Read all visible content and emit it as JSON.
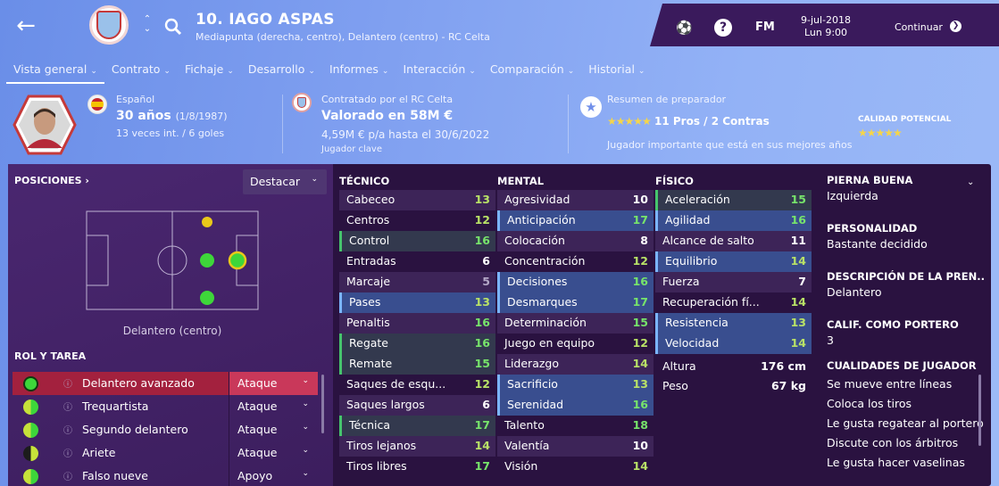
{
  "header": {
    "name": "10. IAGO ASPAS",
    "subtitle": "Mediapunta (derecha, centro), Delantero (centro) - RC Celta",
    "back_icon": "back-arrow-icon",
    "fm": "FM",
    "date": "9-jul-2018",
    "time": "Lun 9:00",
    "continue": "Continuar"
  },
  "tabs": [
    {
      "label": "Vista general"
    },
    {
      "label": "Contrato"
    },
    {
      "label": "Fichaje"
    },
    {
      "label": "Desarrollo"
    },
    {
      "label": "Informes"
    },
    {
      "label": "Interacción"
    },
    {
      "label": "Comparación"
    },
    {
      "label": "Historial"
    }
  ],
  "info": {
    "nationality": "Español",
    "age": "30 años",
    "dob": "(1/8/1987)",
    "caps": "13 veces int. / 6 goles",
    "contract_title": "Contratado por el RC Celta",
    "value": "Valorado en 58M €",
    "wage": "4,59M € p/a hasta el 30/6/2022",
    "status": "Jugador clave",
    "coach_title": "Resumen de preparador",
    "coach_summary": "11 Pros / 2 Contras",
    "coach_note": "Jugador importante que está en sus mejores años",
    "potential_label": "CALIDAD POTENCIAL",
    "coach_stars": 4.5,
    "potential_stars": 4.5
  },
  "positions": {
    "title": "POSICIONES",
    "highlight": "Destacar",
    "pitch_label": "Delantero (centro)"
  },
  "roles": {
    "title": "ROL Y TAREA",
    "items": [
      {
        "name": "Delantero avanzado",
        "task": "Ataque"
      },
      {
        "name": "Trequartista",
        "task": "Ataque"
      },
      {
        "name": "Segundo delantero",
        "task": "Ataque"
      },
      {
        "name": "Ariete",
        "task": "Ataque"
      },
      {
        "name": "Falso nueve",
        "task": "Apoyo"
      }
    ]
  },
  "technical": {
    "title": "TÉCNICO",
    "items": [
      {
        "n": "Cabeceo",
        "v": "13"
      },
      {
        "n": "Centros",
        "v": "12"
      },
      {
        "n": "Control",
        "v": "16"
      },
      {
        "n": "Entradas",
        "v": "6"
      },
      {
        "n": "Marcaje",
        "v": "5"
      },
      {
        "n": "Pases",
        "v": "13"
      },
      {
        "n": "Penaltis",
        "v": "16"
      },
      {
        "n": "Regate",
        "v": "16"
      },
      {
        "n": "Remate",
        "v": "15"
      },
      {
        "n": "Saques de esqu...",
        "v": "12"
      },
      {
        "n": "Saques largos",
        "v": "6"
      },
      {
        "n": "Técnica",
        "v": "17"
      },
      {
        "n": "Tiros lejanos",
        "v": "14"
      },
      {
        "n": "Tiros libres",
        "v": "17"
      }
    ]
  },
  "mental": {
    "title": "MENTAL",
    "items": [
      {
        "n": "Agresividad",
        "v": "10"
      },
      {
        "n": "Anticipación",
        "v": "17"
      },
      {
        "n": "Colocación",
        "v": "8"
      },
      {
        "n": "Concentración",
        "v": "12"
      },
      {
        "n": "Decisiones",
        "v": "16"
      },
      {
        "n": "Desmarques",
        "v": "17"
      },
      {
        "n": "Determinación",
        "v": "15"
      },
      {
        "n": "Juego en equipo",
        "v": "12"
      },
      {
        "n": "Liderazgo",
        "v": "14"
      },
      {
        "n": "Sacrificio",
        "v": "13"
      },
      {
        "n": "Serenidad",
        "v": "16"
      },
      {
        "n": "Talento",
        "v": "18"
      },
      {
        "n": "Valentía",
        "v": "10"
      },
      {
        "n": "Visión",
        "v": "14"
      }
    ]
  },
  "physical": {
    "title": "FÍSICO",
    "items": [
      {
        "n": "Aceleración",
        "v": "15"
      },
      {
        "n": "Agilidad",
        "v": "16"
      },
      {
        "n": "Alcance de salto",
        "v": "11"
      },
      {
        "n": "Equilibrio",
        "v": "14"
      },
      {
        "n": "Fuerza",
        "v": "7"
      },
      {
        "n": "Recuperación fí...",
        "v": "14"
      },
      {
        "n": "Resistencia",
        "v": "13"
      },
      {
        "n": "Velocidad",
        "v": "14"
      }
    ],
    "height_label": "Altura",
    "height": "176 cm",
    "weight_label": "Peso",
    "weight": "67 kg"
  },
  "side": {
    "foot_label": "PIERNA BUENA",
    "foot": "Izquierda",
    "pers_label": "PERSONALIDAD",
    "pers": "Bastante decidido",
    "desc_label": "DESCRIPCIÓN DE LA PREN...",
    "desc": "Delantero",
    "gk_label": "CALIF. COMO PORTERO",
    "gk": "3",
    "traits_label": "CUALIDADES DE JUGADOR",
    "traits": [
      "Se mueve entre líneas",
      "Coloca los tiros",
      "Le gusta regatear al portero",
      "Discute con los árbitros",
      "Le gusta hacer vaselinas"
    ]
  },
  "colors": {
    "panel": "#2a1240",
    "accent_green": "#77e46b",
    "topbar": "#3a1a5c"
  }
}
